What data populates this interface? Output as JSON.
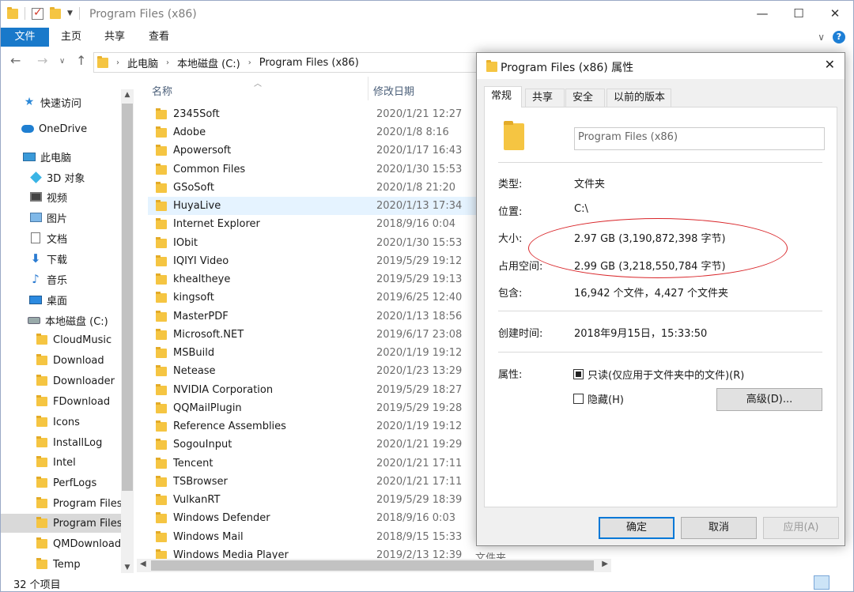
{
  "window": {
    "title": "Program Files (x86)",
    "caption": {
      "minimize": "—",
      "maximize": "☐",
      "close": "✕"
    }
  },
  "ribbon": {
    "tabs": [
      "文件",
      "主页",
      "共享",
      "查看"
    ],
    "expand": "∨",
    "help": "?"
  },
  "address": {
    "crumbs": [
      "此电脑",
      "本地磁盘 (C:)",
      "Program Files (x86)"
    ]
  },
  "sidebar": {
    "items": [
      {
        "label": "快速访问",
        "icon": "star-icon"
      },
      {
        "label": "OneDrive",
        "icon": "cloud-icon"
      },
      {
        "label": "此电脑",
        "icon": "computer-icon"
      },
      {
        "label": "3D 对象",
        "icon": "cube-icon"
      },
      {
        "label": "视频",
        "icon": "video-icon"
      },
      {
        "label": "图片",
        "icon": "picture-icon"
      },
      {
        "label": "文档",
        "icon": "document-icon"
      },
      {
        "label": "下载",
        "icon": "download-icon"
      },
      {
        "label": "音乐",
        "icon": "music-icon"
      },
      {
        "label": "桌面",
        "icon": "desktop-icon"
      },
      {
        "label": "本地磁盘 (C:)",
        "icon": "drive-icon"
      },
      {
        "label": "CloudMusic",
        "icon": "folder-icon"
      },
      {
        "label": "Download",
        "icon": "folder-icon"
      },
      {
        "label": "Downloader",
        "icon": "folder-icon"
      },
      {
        "label": "FDownload",
        "icon": "folder-icon"
      },
      {
        "label": "Icons",
        "icon": "folder-icon"
      },
      {
        "label": "InstallLog",
        "icon": "folder-icon"
      },
      {
        "label": "Intel",
        "icon": "folder-icon"
      },
      {
        "label": "PerfLogs",
        "icon": "folder-icon"
      },
      {
        "label": "Program Files",
        "icon": "folder-icon"
      },
      {
        "label": "Program Files",
        "icon": "folder-icon"
      },
      {
        "label": "QMDownload",
        "icon": "folder-icon"
      },
      {
        "label": "Temp",
        "icon": "folder-icon"
      }
    ]
  },
  "list": {
    "headers": {
      "name": "名称",
      "date": "修改日期"
    },
    "extra_type": "文件夹",
    "rows": [
      {
        "name": "2345Soft",
        "date": "2020/1/21 12:27"
      },
      {
        "name": "Adobe",
        "date": "2020/1/8 8:16"
      },
      {
        "name": "Apowersoft",
        "date": "2020/1/17 16:43"
      },
      {
        "name": "Common Files",
        "date": "2020/1/30 15:53"
      },
      {
        "name": "GSoSoft",
        "date": "2020/1/8 21:20"
      },
      {
        "name": "HuyaLive",
        "date": "2020/1/13 17:34"
      },
      {
        "name": "Internet Explorer",
        "date": "2018/9/16 0:04"
      },
      {
        "name": "IObit",
        "date": "2020/1/30 15:53"
      },
      {
        "name": "IQIYI Video",
        "date": "2019/5/29 19:12"
      },
      {
        "name": "khealtheye",
        "date": "2019/5/29 19:13"
      },
      {
        "name": "kingsoft",
        "date": "2019/6/25 12:40"
      },
      {
        "name": "MasterPDF",
        "date": "2020/1/13 18:56"
      },
      {
        "name": "Microsoft.NET",
        "date": "2019/6/17 23:08"
      },
      {
        "name": "MSBuild",
        "date": "2020/1/19 19:12"
      },
      {
        "name": "Netease",
        "date": "2020/1/23 13:29"
      },
      {
        "name": "NVIDIA Corporation",
        "date": "2019/5/29 18:27"
      },
      {
        "name": "QQMailPlugin",
        "date": "2019/5/29 19:28"
      },
      {
        "name": "Reference Assemblies",
        "date": "2020/1/19 19:12"
      },
      {
        "name": "SogouInput",
        "date": "2020/1/21 19:29"
      },
      {
        "name": "Tencent",
        "date": "2020/1/21 17:11"
      },
      {
        "name": "TSBrowser",
        "date": "2020/1/21 17:11"
      },
      {
        "name": "VulkanRT",
        "date": "2019/5/29 18:39"
      },
      {
        "name": "Windows Defender",
        "date": "2018/9/16 0:03"
      },
      {
        "name": "Windows Mail",
        "date": "2018/9/15 15:33"
      },
      {
        "name": "Windows Media Player",
        "date": "2019/2/13 12:39"
      }
    ]
  },
  "status": {
    "count": "32 个项目"
  },
  "dialog": {
    "title": "Program Files (x86) 属性",
    "tabs": [
      "常规",
      "共享",
      "安全",
      "以前的版本"
    ],
    "name_field": "Program Files (x86)",
    "props": [
      {
        "label": "类型:",
        "value": "文件夹"
      },
      {
        "label": "位置:",
        "value": "C:\\"
      },
      {
        "label": "大小:",
        "value": "2.97 GB (3,190,872,398 字节)"
      },
      {
        "label": "占用空间:",
        "value": "2.99 GB (3,218,550,784 字节)"
      },
      {
        "label": "包含:",
        "value": "16,942 个文件，4,427 个文件夹"
      },
      {
        "label": "创建时间:",
        "value": "2018年9月15日，15:33:50"
      }
    ],
    "attributes_label": "属性:",
    "readonly_label": "只读(仅应用于文件夹中的文件)(R)",
    "hidden_label": "隐藏(H)",
    "advanced_button": "高级(D)...",
    "ok": "确定",
    "cancel": "取消",
    "apply": "应用(A)"
  }
}
